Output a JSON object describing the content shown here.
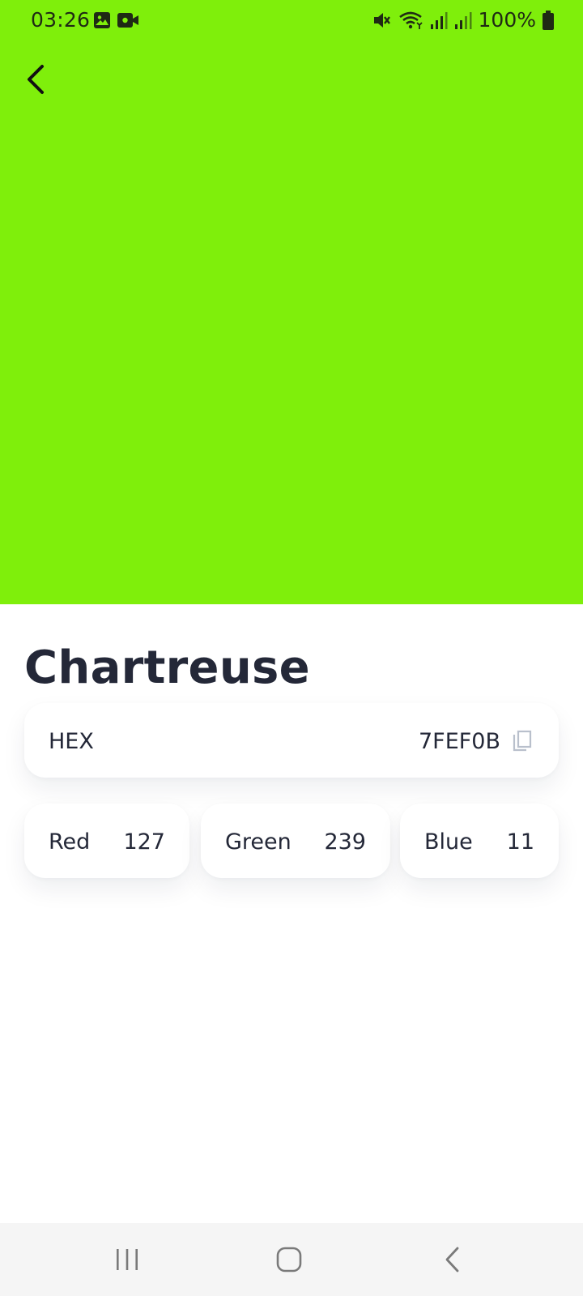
{
  "status_bar": {
    "time": "03:26",
    "battery": "100%",
    "left_icons": [
      "image-icon",
      "video-icon"
    ],
    "right_icons": [
      "mute-icon",
      "wifi-icon",
      "signal-icon",
      "signal-icon",
      "battery-icon"
    ]
  },
  "colors": {
    "swatch": "#7FEF0B",
    "text_dark": "#242838",
    "nav_bg": "#f5f5f5"
  },
  "color_detail": {
    "name": "Chartreuse",
    "hex_label": "HEX",
    "hex_value": "7FEF0B",
    "rgb": [
      {
        "label": "Red",
        "value": "127"
      },
      {
        "label": "Green",
        "value": "239"
      },
      {
        "label": "Blue",
        "value": "11"
      }
    ]
  },
  "icons": {
    "back": "chevron-left-icon",
    "copy": "copy-icon",
    "nav_recents": "recents-icon",
    "nav_home": "home-icon",
    "nav_back": "back-icon"
  }
}
